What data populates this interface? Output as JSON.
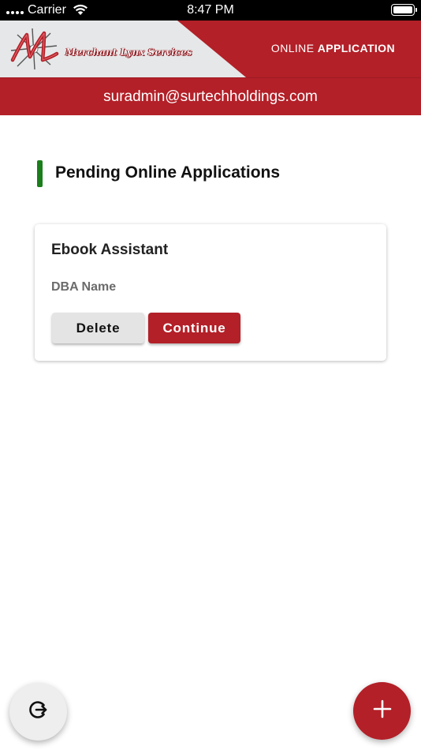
{
  "status_bar": {
    "carrier": "Carrier",
    "time": "8:47 PM"
  },
  "header": {
    "logo_text": "Merchant Lynx Services",
    "title_normal": "ONLINE",
    "title_bold": "APPLICATION",
    "brand_color": "#b32028"
  },
  "user": {
    "email": "suradmin@surtechholdings.com"
  },
  "section": {
    "title": "Pending Online Applications",
    "accent_color": "#1a7e1a"
  },
  "applications": [
    {
      "title": "Ebook Assistant",
      "subtitle": "DBA Name",
      "delete_label": "Delete",
      "continue_label": "Continue"
    }
  ],
  "fabs": {
    "logout_icon": "logout-icon",
    "add_icon": "plus-icon"
  }
}
